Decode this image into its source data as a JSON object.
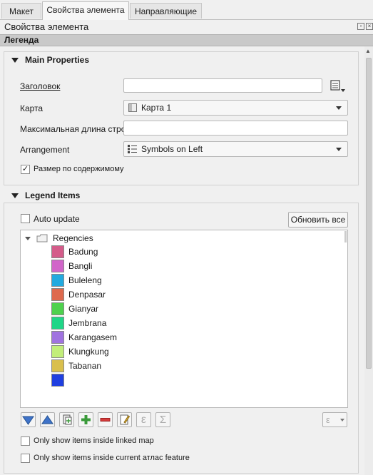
{
  "tabs": [
    {
      "label": "Макет"
    },
    {
      "label": "Свойства элемента"
    },
    {
      "label": "Направляющие"
    }
  ],
  "dock_title": "Свойства элемента",
  "panel_header": "Легенда",
  "main_properties": {
    "title": "Main Properties",
    "title_label": "Заголовок",
    "title_value": "",
    "map_label": "Карта",
    "map_value": "Карта 1",
    "wrap_label": "Максимальная длина строк",
    "wrap_value": "",
    "arrangement_label": "Arrangement",
    "arrangement_value": "Symbols on Left",
    "resize_label": "Размер по содержимому",
    "resize_checked": true
  },
  "legend_items": {
    "title": "Legend Items",
    "auto_update_label": "Auto update",
    "update_all_label": "Обновить все",
    "group_name": "Regencies",
    "items": [
      {
        "name": "Badung",
        "color": "#d45c8a"
      },
      {
        "name": "Bangli",
        "color": "#d166c9"
      },
      {
        "name": "Buleleng",
        "color": "#22aadf"
      },
      {
        "name": "Denpasar",
        "color": "#de6a4e"
      },
      {
        "name": "Gianyar",
        "color": "#4ed14e"
      },
      {
        "name": "Jembrana",
        "color": "#1fd687"
      },
      {
        "name": "Karangasem",
        "color": "#a073e0"
      },
      {
        "name": "Klungkung",
        "color": "#c2ee7a"
      },
      {
        "name": "Tabanan",
        "color": "#d9bf4d"
      },
      {
        "name": "",
        "color": "#1f3fe0"
      }
    ],
    "only_linked_map_label": "Only show items inside linked map",
    "only_atlas_label": "Only show items inside current атлас feature"
  }
}
